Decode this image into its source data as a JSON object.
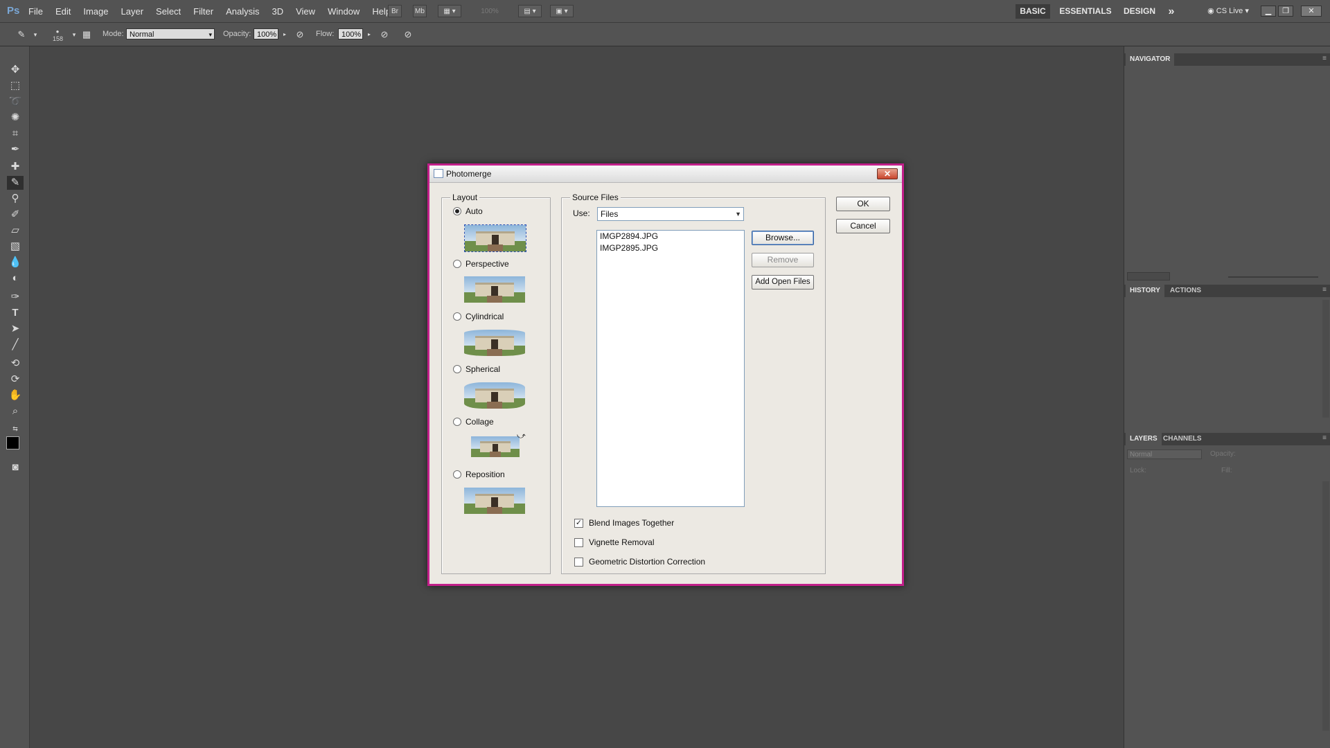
{
  "app": {
    "logo": "Ps",
    "menus": [
      "File",
      "Edit",
      "Image",
      "Layer",
      "Select",
      "Filter",
      "Analysis",
      "3D",
      "View",
      "Window",
      "Help"
    ],
    "toolbar_buttons": [
      "Br",
      "Mb"
    ],
    "zoom": "100%",
    "workspaces": [
      "BASIC",
      "ESSENTIALS",
      "DESIGN"
    ],
    "more": "»",
    "cs_live": "CS Live"
  },
  "options_bar": {
    "brush_size": "158",
    "mode_label": "Mode:",
    "mode_value": "Normal",
    "opacity_label": "Opacity:",
    "opacity_value": "100%",
    "flow_label": "Flow:",
    "flow_value": "100%"
  },
  "panels": {
    "navigator": "NAVIGATOR",
    "history": "HISTORY",
    "actions": "ACTIONS",
    "layers": "LAYERS",
    "channels": "CHANNELS",
    "blend_mode": "Normal",
    "opacity_label": "Opacity:",
    "lock_label": "Lock:",
    "fill_label": "Fill:"
  },
  "dialog": {
    "title": "Photomerge",
    "close": "✕",
    "layout": {
      "legend": "Layout",
      "options": [
        {
          "label": "Auto",
          "selected": true
        },
        {
          "label": "Perspective",
          "selected": false
        },
        {
          "label": "Cylindrical",
          "selected": false
        },
        {
          "label": "Spherical",
          "selected": false
        },
        {
          "label": "Collage",
          "selected": false
        },
        {
          "label": "Reposition",
          "selected": false
        }
      ]
    },
    "source": {
      "legend": "Source Files",
      "use_label": "Use:",
      "use_value": "Files",
      "files": [
        "IMGP2894.JPG",
        "IMGP2895.JPG"
      ],
      "browse": "Browse...",
      "remove": "Remove",
      "add_open": "Add Open Files",
      "checks": [
        {
          "label": "Blend Images Together",
          "checked": true
        },
        {
          "label": "Vignette Removal",
          "checked": false
        },
        {
          "label": "Geometric Distortion Correction",
          "checked": false
        }
      ]
    },
    "ok": "OK",
    "cancel": "Cancel"
  },
  "colors": {
    "dialog_border": "#c21f8a",
    "canvas_bg": "#474747",
    "panel_bg": "#535353"
  }
}
